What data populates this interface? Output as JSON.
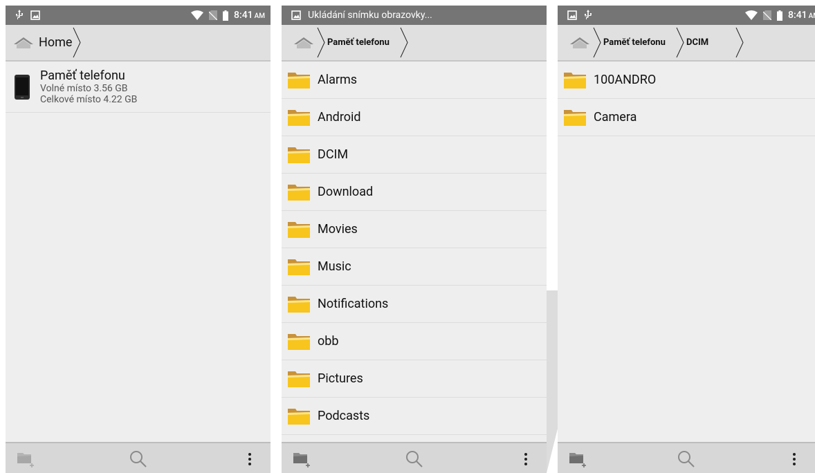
{
  "status_bar": {
    "time": "8:41",
    "ampm": "AM",
    "screenshot_notice": "Ukládání snímku obrazovky..."
  },
  "panel1": {
    "breadcrumb": {
      "home_label": "Home"
    },
    "storage": {
      "name": "Paměť telefonu",
      "free": "Volné místo 3.56 GB",
      "total": "Celkové místo 4.22 GB"
    }
  },
  "panel2": {
    "breadcrumb": {
      "crumb": "Paměť telefonu"
    },
    "folders": [
      "Alarms",
      "Android",
      "DCIM",
      "Download",
      "Movies",
      "Music",
      "Notifications",
      "obb",
      "Pictures",
      "Podcasts"
    ]
  },
  "panel3": {
    "breadcrumb": {
      "crumb1": "Paměť telefonu",
      "crumb2": "DCIM"
    },
    "folders": [
      "100ANDRO",
      "Camera"
    ]
  },
  "colors": {
    "status_bar": "#757575",
    "breadcrumb_bg": "#e0e0e0",
    "list_bg": "#eeeeee",
    "bottom_bar": "#d7d7d7",
    "folder_yellow": "#f7c51d"
  },
  "icons": {
    "usb": "usb-icon",
    "image": "image-icon",
    "wifi": "wifi-icon",
    "no_sim": "no-sim-icon",
    "battery": "battery-icon",
    "home": "home-icon",
    "folder": "folder-icon",
    "phone": "phone-device-icon",
    "new_folder": "new-folder-icon",
    "search": "search-icon",
    "more": "more-vert-icon"
  }
}
